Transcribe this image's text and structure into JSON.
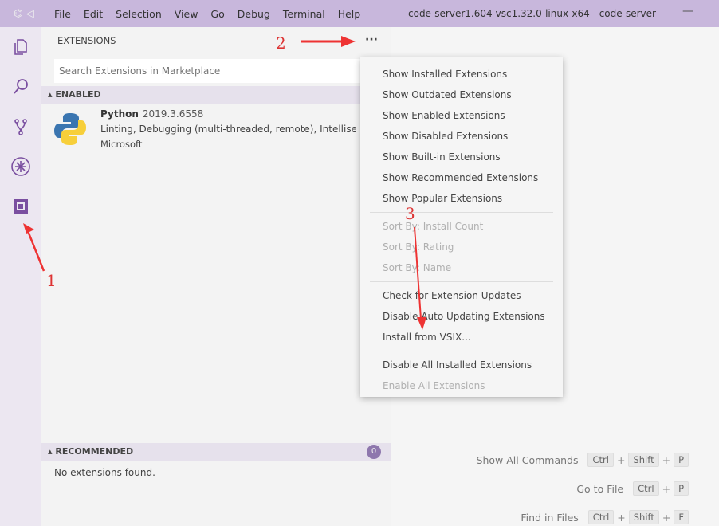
{
  "titlebar": {
    "menus": [
      "File",
      "Edit",
      "Selection",
      "View",
      "Go",
      "Debug",
      "Terminal",
      "Help"
    ],
    "title": "code-server1.604-vsc1.32.0-linux-x64 - code-server",
    "minimize": "—"
  },
  "sidebar": {
    "title": "EXTENSIONS",
    "more": "···",
    "search_placeholder": "Search Extensions in Marketplace",
    "enabled_header": "ENABLED",
    "extension": {
      "name": "Python",
      "version": "2019.3.6558",
      "description": "Linting, Debugging (multi-threaded, remote), Intellisense",
      "publisher": "Microsoft"
    },
    "recommended_header": "RECOMMENDED",
    "recommended_count": "0",
    "no_extensions": "No extensions found."
  },
  "context_menu": {
    "groups": [
      [
        {
          "label": "Show Installed Extensions",
          "enabled": true
        },
        {
          "label": "Show Outdated Extensions",
          "enabled": true
        },
        {
          "label": "Show Enabled Extensions",
          "enabled": true
        },
        {
          "label": "Show Disabled Extensions",
          "enabled": true
        },
        {
          "label": "Show Built-in Extensions",
          "enabled": true
        },
        {
          "label": "Show Recommended Extensions",
          "enabled": true
        },
        {
          "label": "Show Popular Extensions",
          "enabled": true
        }
      ],
      [
        {
          "label": "Sort By: Install Count",
          "enabled": false
        },
        {
          "label": "Sort By: Rating",
          "enabled": false
        },
        {
          "label": "Sort By: Name",
          "enabled": false
        }
      ],
      [
        {
          "label": "Check for Extension Updates",
          "enabled": true
        },
        {
          "label": "Disable Auto Updating Extensions",
          "enabled": true
        },
        {
          "label": "Install from VSIX...",
          "enabled": true
        }
      ],
      [
        {
          "label": "Disable All Installed Extensions",
          "enabled": true
        },
        {
          "label": "Enable All Extensions",
          "enabled": false
        }
      ]
    ]
  },
  "shortcuts": [
    {
      "label": "Show All Commands",
      "keys": [
        "Ctrl",
        "Shift",
        "P"
      ]
    },
    {
      "label": "Go to File",
      "keys": [
        "Ctrl",
        "P"
      ]
    },
    {
      "label": "Find in Files",
      "keys": [
        "Ctrl",
        "Shift",
        "F"
      ]
    }
  ],
  "annotations": [
    "1",
    "2",
    "3"
  ],
  "colors": {
    "titlebar": "#c8b7dc",
    "accent": "#7a4fa0",
    "annotation": "#dd3333"
  }
}
